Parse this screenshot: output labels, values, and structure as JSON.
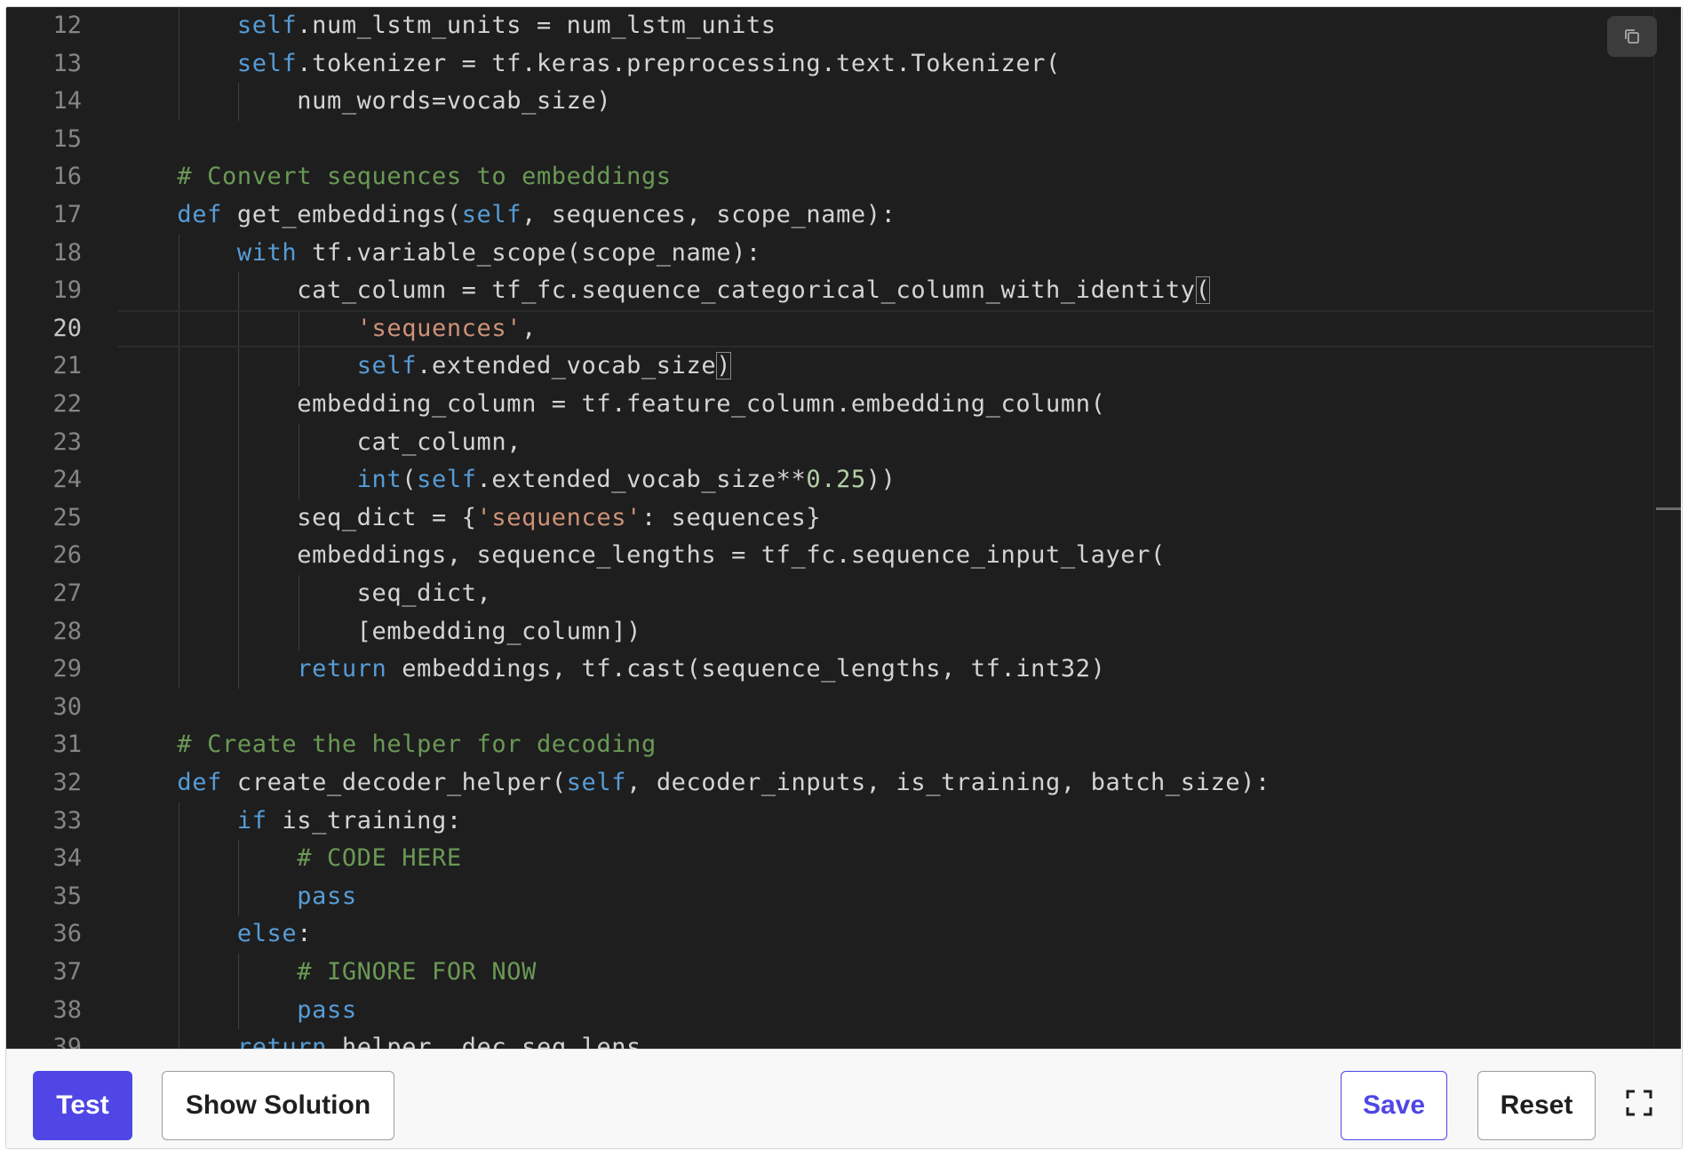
{
  "editor": {
    "first_line_number": 12,
    "active_line_number": 20,
    "lines": [
      [
        {
          "t": "        "
        },
        {
          "t": "self",
          "c": "kw"
        },
        {
          "t": ".num_lstm_units = num_lstm_units"
        }
      ],
      [
        {
          "t": "        "
        },
        {
          "t": "self",
          "c": "kw"
        },
        {
          "t": ".tokenizer = tf.keras.preprocessing.text.Tokenizer("
        }
      ],
      [
        {
          "t": "            num_words=vocab_size)"
        }
      ],
      [],
      [
        {
          "t": "    "
        },
        {
          "t": "# Convert sequences to embeddings",
          "c": "cm"
        }
      ],
      [
        {
          "t": "    "
        },
        {
          "t": "def",
          "c": "kw"
        },
        {
          "t": " get_embeddings("
        },
        {
          "t": "self",
          "c": "kw"
        },
        {
          "t": ", sequences, scope_name):"
        }
      ],
      [
        {
          "t": "        "
        },
        {
          "t": "with",
          "c": "kw"
        },
        {
          "t": " tf.variable_scope(scope_name):"
        }
      ],
      [
        {
          "t": "            cat_column = tf_fc.sequence_categorical_column_with_identity"
        },
        {
          "t": "(",
          "c": "br"
        }
      ],
      [
        {
          "t": "                "
        },
        {
          "t": "'sequences'",
          "c": "st"
        },
        {
          "t": ","
        }
      ],
      [
        {
          "t": "                "
        },
        {
          "t": "self",
          "c": "kw"
        },
        {
          "t": ".extended_vocab_size"
        },
        {
          "t": ")",
          "c": "br"
        }
      ],
      [
        {
          "t": "            embedding_column = tf.feature_column.embedding_column("
        }
      ],
      [
        {
          "t": "                cat_column,"
        }
      ],
      [
        {
          "t": "                "
        },
        {
          "t": "int",
          "c": "kw"
        },
        {
          "t": "("
        },
        {
          "t": "self",
          "c": "kw"
        },
        {
          "t": ".extended_vocab_size**"
        },
        {
          "t": "0.25",
          "c": "nm"
        },
        {
          "t": "))"
        }
      ],
      [
        {
          "t": "            seq_dict = {"
        },
        {
          "t": "'sequences'",
          "c": "st"
        },
        {
          "t": ": sequences}"
        }
      ],
      [
        {
          "t": "            embeddings, sequence_lengths = tf_fc.sequence_input_layer("
        }
      ],
      [
        {
          "t": "                seq_dict,"
        }
      ],
      [
        {
          "t": "                [embedding_column])"
        }
      ],
      [
        {
          "t": "            "
        },
        {
          "t": "return",
          "c": "kw"
        },
        {
          "t": " embeddings, tf.cast(sequence_lengths, tf.int32)"
        }
      ],
      [],
      [
        {
          "t": "    "
        },
        {
          "t": "# Create the helper for decoding",
          "c": "cm"
        }
      ],
      [
        {
          "t": "    "
        },
        {
          "t": "def",
          "c": "kw"
        },
        {
          "t": " create_decoder_helper("
        },
        {
          "t": "self",
          "c": "kw"
        },
        {
          "t": ", decoder_inputs, is_training, batch_size):"
        }
      ],
      [
        {
          "t": "        "
        },
        {
          "t": "if",
          "c": "kw"
        },
        {
          "t": " is_training:"
        }
      ],
      [
        {
          "t": "            "
        },
        {
          "t": "# CODE HERE",
          "c": "cm"
        }
      ],
      [
        {
          "t": "            "
        },
        {
          "t": "pass",
          "c": "kw"
        }
      ],
      [
        {
          "t": "        "
        },
        {
          "t": "else",
          "c": "kw"
        },
        {
          "t": ":"
        }
      ],
      [
        {
          "t": "            "
        },
        {
          "t": "# IGNORE FOR NOW",
          "c": "cm"
        }
      ],
      [
        {
          "t": "            "
        },
        {
          "t": "pass",
          "c": "kw"
        }
      ],
      [
        {
          "t": "        "
        },
        {
          "t": "return",
          "c": "kw"
        },
        {
          "t": " helper, dec_seq_lens"
        }
      ]
    ]
  },
  "toolbar": {
    "test_label": "Test",
    "solution_label": "Show Solution",
    "save_label": "Save",
    "reset_label": "Reset"
  },
  "icons": {
    "copy": "copy-icon",
    "fullscreen": "fullscreen-icon"
  },
  "colors": {
    "primary": "#4f46e5",
    "editor_bg": "#1e1e1e",
    "keyword": "#569cd6",
    "comment": "#6a9955",
    "string": "#ce9178",
    "number": "#b5cea8"
  }
}
